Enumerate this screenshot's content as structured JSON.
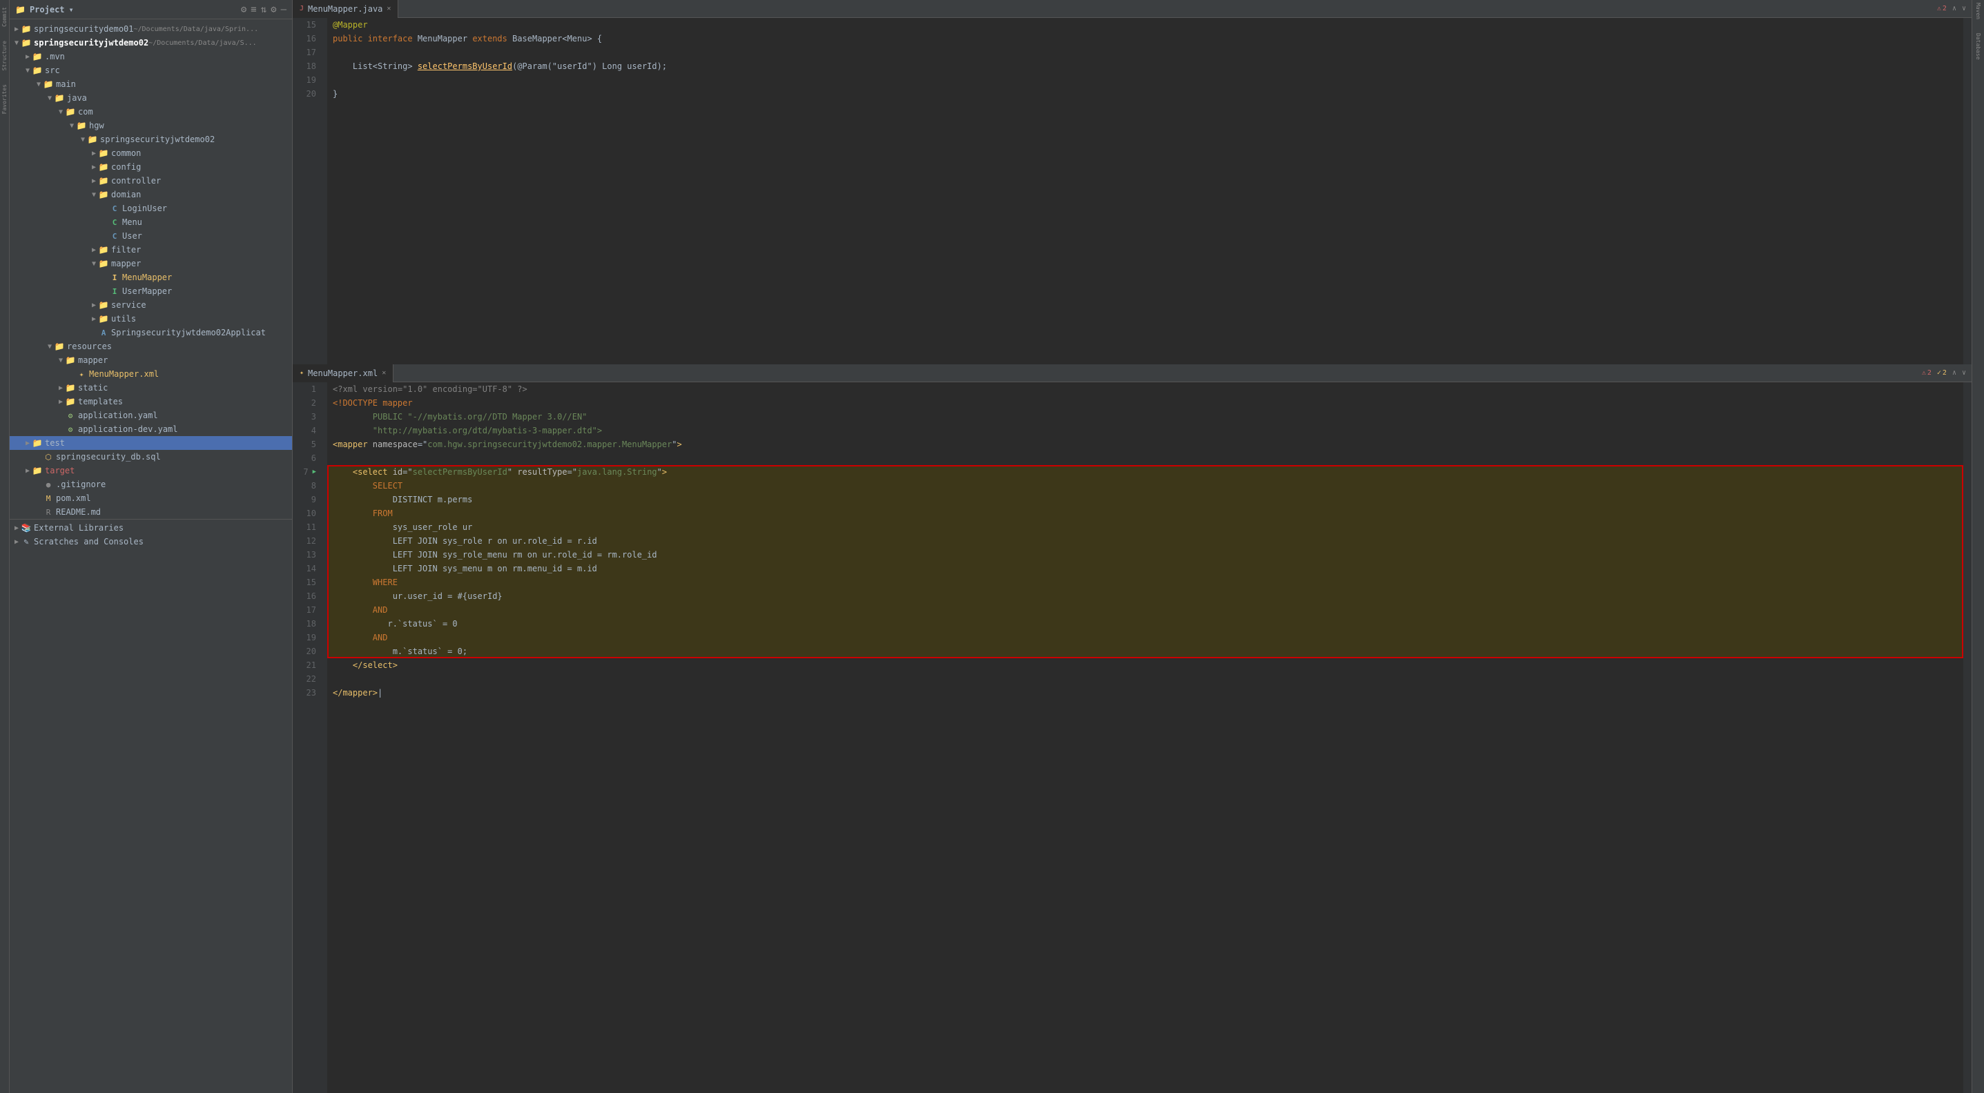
{
  "leftSidebar": {
    "icons": [
      "Commit",
      "Structure",
      "Favorites"
    ]
  },
  "projectPanel": {
    "title": "Project",
    "headerIcons": [
      "⚙",
      "≡",
      "⇅",
      "⚙",
      "—"
    ],
    "tree": [
      {
        "id": "sp1",
        "level": 0,
        "arrow": "▶",
        "icon": "📁",
        "iconClass": "icon-folder",
        "label": "springsecuritydemo01",
        "path": "~/Documents/Data/java/Sprin...",
        "type": "folder"
      },
      {
        "id": "sp2",
        "level": 0,
        "arrow": "▼",
        "icon": "📁",
        "iconClass": "icon-folder",
        "label": "springsecurityjwtdemo02",
        "path": "~/Documents/Data/java/S...",
        "type": "folder",
        "expanded": true
      },
      {
        "id": "mvn",
        "level": 1,
        "arrow": "▶",
        "icon": "📁",
        "iconClass": "icon-folder",
        "label": ".mvn",
        "type": "folder"
      },
      {
        "id": "src",
        "level": 1,
        "arrow": "▼",
        "icon": "📁",
        "iconClass": "icon-src",
        "label": "src",
        "type": "folder",
        "expanded": true
      },
      {
        "id": "main",
        "level": 2,
        "arrow": "▼",
        "icon": "📁",
        "iconClass": "icon-folder",
        "label": "main",
        "type": "folder",
        "expanded": true
      },
      {
        "id": "java",
        "level": 3,
        "arrow": "▼",
        "icon": "📁",
        "iconClass": "icon-folder",
        "label": "java",
        "type": "folder",
        "expanded": true
      },
      {
        "id": "com",
        "level": 4,
        "arrow": "▼",
        "icon": "📁",
        "iconClass": "icon-folder",
        "label": "com",
        "type": "folder",
        "expanded": true
      },
      {
        "id": "hgw",
        "level": 5,
        "arrow": "▼",
        "icon": "📁",
        "iconClass": "icon-folder",
        "label": "hgw",
        "type": "folder",
        "expanded": true
      },
      {
        "id": "ssjd",
        "level": 6,
        "arrow": "▼",
        "icon": "📁",
        "iconClass": "icon-folder",
        "label": "springsecurityjwtdemo02",
        "type": "folder",
        "expanded": true
      },
      {
        "id": "common",
        "level": 7,
        "arrow": "▶",
        "icon": "📁",
        "iconClass": "icon-folder",
        "label": "common",
        "type": "folder"
      },
      {
        "id": "config",
        "level": 7,
        "arrow": "▶",
        "icon": "📁",
        "iconClass": "icon-folder",
        "label": "config",
        "type": "folder"
      },
      {
        "id": "controller",
        "level": 7,
        "arrow": "▶",
        "icon": "📁",
        "iconClass": "icon-folder",
        "label": "controller",
        "type": "folder"
      },
      {
        "id": "domian",
        "level": 7,
        "arrow": "▼",
        "icon": "📁",
        "iconClass": "icon-folder",
        "label": "domian",
        "type": "folder",
        "expanded": true
      },
      {
        "id": "LoginUser",
        "level": 8,
        "arrow": " ",
        "icon": "C",
        "iconClass": "icon-class-blue",
        "label": "LoginUser",
        "type": "class"
      },
      {
        "id": "Menu",
        "level": 8,
        "arrow": " ",
        "icon": "C",
        "iconClass": "icon-class-green",
        "label": "Menu",
        "type": "class"
      },
      {
        "id": "User",
        "level": 8,
        "arrow": " ",
        "icon": "C",
        "iconClass": "icon-class-blue",
        "label": "User",
        "type": "class"
      },
      {
        "id": "filter",
        "level": 7,
        "arrow": "▶",
        "icon": "📁",
        "iconClass": "icon-folder",
        "label": "filter",
        "type": "folder"
      },
      {
        "id": "mapper",
        "level": 7,
        "arrow": "▼",
        "icon": "📁",
        "iconClass": "icon-folder",
        "label": "mapper",
        "type": "folder",
        "expanded": true
      },
      {
        "id": "MenuMapper",
        "level": 8,
        "arrow": " ",
        "icon": "I",
        "iconClass": "icon-xml",
        "label": "MenuMapper",
        "type": "interface",
        "highlighted": true
      },
      {
        "id": "UserMapper",
        "level": 8,
        "arrow": " ",
        "icon": "I",
        "iconClass": "icon-class-green",
        "label": "UserMapper",
        "type": "interface"
      },
      {
        "id": "service",
        "level": 7,
        "arrow": "▶",
        "icon": "📁",
        "iconClass": "icon-folder",
        "label": "service",
        "type": "folder"
      },
      {
        "id": "utils",
        "level": 7,
        "arrow": "▶",
        "icon": "📁",
        "iconClass": "icon-folder",
        "label": "utils",
        "type": "folder"
      },
      {
        "id": "SpringApp",
        "level": 7,
        "arrow": " ",
        "icon": "A",
        "iconClass": "icon-class-blue",
        "label": "Springsecurityjwtdemo02Applicat",
        "type": "class"
      },
      {
        "id": "resources",
        "level": 3,
        "arrow": "▼",
        "icon": "📁",
        "iconClass": "icon-folder",
        "label": "resources",
        "type": "folder",
        "expanded": true
      },
      {
        "id": "resMapper",
        "level": 4,
        "arrow": "▼",
        "icon": "📁",
        "iconClass": "icon-folder",
        "label": "mapper",
        "type": "folder",
        "expanded": true
      },
      {
        "id": "MenuMapperXml",
        "level": 5,
        "arrow": " ",
        "icon": "X",
        "iconClass": "icon-xml",
        "label": "MenuMapper.xml",
        "type": "xml"
      },
      {
        "id": "static",
        "level": 4,
        "arrow": "▶",
        "icon": "📁",
        "iconClass": "icon-folder",
        "label": "static",
        "type": "folder"
      },
      {
        "id": "templates",
        "level": 4,
        "arrow": "▶",
        "icon": "📁",
        "iconClass": "icon-folder",
        "label": "templates",
        "type": "folder"
      },
      {
        "id": "appYaml",
        "level": 4,
        "arrow": " ",
        "icon": "Y",
        "iconClass": "icon-yaml",
        "label": "application.yaml",
        "type": "yaml"
      },
      {
        "id": "appDevYaml",
        "level": 4,
        "arrow": " ",
        "icon": "Y",
        "iconClass": "icon-yaml",
        "label": "application-dev.yaml",
        "type": "yaml"
      },
      {
        "id": "test",
        "level": 1,
        "arrow": "▶",
        "icon": "📁",
        "iconClass": "icon-folder",
        "label": "test",
        "type": "folder"
      },
      {
        "id": "sqlFile",
        "level": 2,
        "arrow": " ",
        "icon": "S",
        "iconClass": "icon-sql",
        "label": "springsecurity_db.sql",
        "type": "sql"
      },
      {
        "id": "target",
        "level": 1,
        "arrow": "▶",
        "icon": "📁",
        "iconClass": "icon-folder",
        "label": "target",
        "type": "folder",
        "selected": true
      },
      {
        "id": "gitignore",
        "level": 2,
        "arrow": " ",
        "icon": "G",
        "iconClass": "icon-git",
        "label": ".gitignore",
        "type": "git"
      },
      {
        "id": "pom",
        "level": 2,
        "arrow": " ",
        "icon": "M",
        "iconClass": "icon-maven",
        "label": "pom.xml",
        "type": "xml"
      },
      {
        "id": "readme",
        "level": 2,
        "arrow": " ",
        "icon": "R",
        "iconClass": "icon-git",
        "label": "README.md",
        "type": "md"
      }
    ],
    "bottomItems": [
      {
        "label": "External Libraries",
        "arrow": "▶",
        "level": 0
      },
      {
        "label": "Scratches and Consoles",
        "arrow": "▶",
        "level": 0
      }
    ]
  },
  "editorTop": {
    "filename": "MenuMapper.java",
    "content": [
      {
        "line": 15,
        "tokens": [
          {
            "text": "@Mapper",
            "cls": "ann"
          }
        ]
      },
      {
        "line": 16,
        "tokens": [
          {
            "text": "public ",
            "cls": "kw"
          },
          {
            "text": "interface ",
            "cls": "kw"
          },
          {
            "text": "MenuMapper ",
            "cls": "normal"
          },
          {
            "text": "extends ",
            "cls": "kw"
          },
          {
            "text": "BaseMapper",
            "cls": "normal"
          },
          {
            "text": "<Menu> {",
            "cls": "normal"
          }
        ]
      },
      {
        "line": 17,
        "tokens": []
      },
      {
        "line": 18,
        "tokens": [
          {
            "text": "    List<String> ",
            "cls": "normal"
          },
          {
            "text": "selectPermsByUserId",
            "cls": "fn"
          },
          {
            "text": "(@Param(\"userId\") Long userId);",
            "cls": "normal"
          }
        ]
      },
      {
        "line": 19,
        "tokens": []
      },
      {
        "line": 20,
        "tokens": [
          {
            "text": "}",
            "cls": "normal"
          }
        ]
      }
    ],
    "errors": 2,
    "warnings": 0
  },
  "editorBottom": {
    "filename": "MenuMapper.xml",
    "content": [
      {
        "line": 1,
        "tokens": [
          {
            "text": "<?xml version=\"1.0\" encoding=\"UTF-8\" ?>",
            "cls": "xml-decl"
          }
        ]
      },
      {
        "line": 2,
        "tokens": [
          {
            "text": "<!DOCTYPE mapper",
            "cls": "xml-keyword"
          }
        ]
      },
      {
        "line": 3,
        "tokens": [
          {
            "text": "        PUBLIC \"-//mybatis.org//DTD Mapper 3.0//EN\"",
            "cls": "str"
          }
        ]
      },
      {
        "line": 4,
        "tokens": [
          {
            "text": "        \"http://mybatis.org/dtd/mybatis-3-mapper.dtd\">",
            "cls": "str"
          }
        ]
      },
      {
        "line": 5,
        "tokens": [
          {
            "text": "<mapper ",
            "cls": "tag"
          },
          {
            "text": "namespace",
            "cls": "attr"
          },
          {
            "text": "=",
            "cls": "normal"
          },
          {
            "text": "\"com.hgw.springsecurityjwtdemo02.mapper.MenuMapper\"",
            "cls": "str"
          },
          {
            "text": ">",
            "cls": "tag"
          }
        ]
      },
      {
        "line": 6,
        "tokens": []
      },
      {
        "line": 7,
        "tokens": [
          {
            "text": "    <select ",
            "cls": "tag"
          },
          {
            "text": "id",
            "cls": "attr"
          },
          {
            "text": "=",
            "cls": "normal"
          },
          {
            "text": "\"selectPermsByUserId\"",
            "cls": "str"
          },
          {
            "text": " resultType",
            "cls": "attr"
          },
          {
            "text": "=",
            "cls": "normal"
          },
          {
            "text": "\"java.lang.String\"",
            "cls": "str"
          },
          {
            "text": ">",
            "cls": "tag"
          }
        ],
        "highlighted": true
      },
      {
        "line": 8,
        "tokens": [
          {
            "text": "        SELECT",
            "cls": "sql-kw"
          }
        ],
        "highlighted": true
      },
      {
        "line": 9,
        "tokens": [
          {
            "text": "            DISTINCT m.perms",
            "cls": "normal"
          }
        ],
        "highlighted": true
      },
      {
        "line": 10,
        "tokens": [
          {
            "text": "        FROM",
            "cls": "sql-kw"
          }
        ],
        "highlighted": true
      },
      {
        "line": 11,
        "tokens": [
          {
            "text": "            sys_user_role ur",
            "cls": "normal"
          }
        ],
        "highlighted": true
      },
      {
        "line": 12,
        "tokens": [
          {
            "text": "            LEFT JOIN sys_role r on ur.role_id = r.id",
            "cls": "normal"
          }
        ],
        "highlighted": true
      },
      {
        "line": 13,
        "tokens": [
          {
            "text": "            LEFT JOIN sys_role_menu rm on ur.role_id = rm.role_id",
            "cls": "normal"
          }
        ],
        "highlighted": true
      },
      {
        "line": 14,
        "tokens": [
          {
            "text": "            LEFT JOIN sys_menu m on rm.menu_id = m.id",
            "cls": "normal"
          }
        ],
        "highlighted": true
      },
      {
        "line": 15,
        "tokens": [
          {
            "text": "        WHERE",
            "cls": "sql-kw"
          }
        ],
        "highlighted": true
      },
      {
        "line": 16,
        "tokens": [
          {
            "text": "            ur.user_id = #{userId}",
            "cls": "normal"
          }
        ],
        "highlighted": true
      },
      {
        "line": 17,
        "tokens": [
          {
            "text": "        AND",
            "cls": "sql-kw"
          }
        ],
        "highlighted": true
      },
      {
        "line": 18,
        "tokens": [
          {
            "text": "            r.`status` = 0",
            "cls": "normal"
          }
        ],
        "highlighted": true
      },
      {
        "line": 19,
        "tokens": [
          {
            "text": "        AND",
            "cls": "sql-kw"
          }
        ],
        "highlighted": true
      },
      {
        "line": 20,
        "tokens": [
          {
            "text": "            m.`status` = 0;",
            "cls": "normal"
          }
        ],
        "highlighted": true
      },
      {
        "line": 21,
        "tokens": [
          {
            "text": "    </select>",
            "cls": "tag"
          }
        ]
      },
      {
        "line": 22,
        "tokens": []
      },
      {
        "line": 23,
        "tokens": [
          {
            "text": "</mapper>",
            "cls": "tag"
          },
          {
            "text": "|",
            "cls": "normal"
          }
        ]
      }
    ],
    "errors": 2,
    "warnings": 2
  },
  "rightSidebar": {
    "items": [
      "Maven",
      "Database"
    ]
  }
}
